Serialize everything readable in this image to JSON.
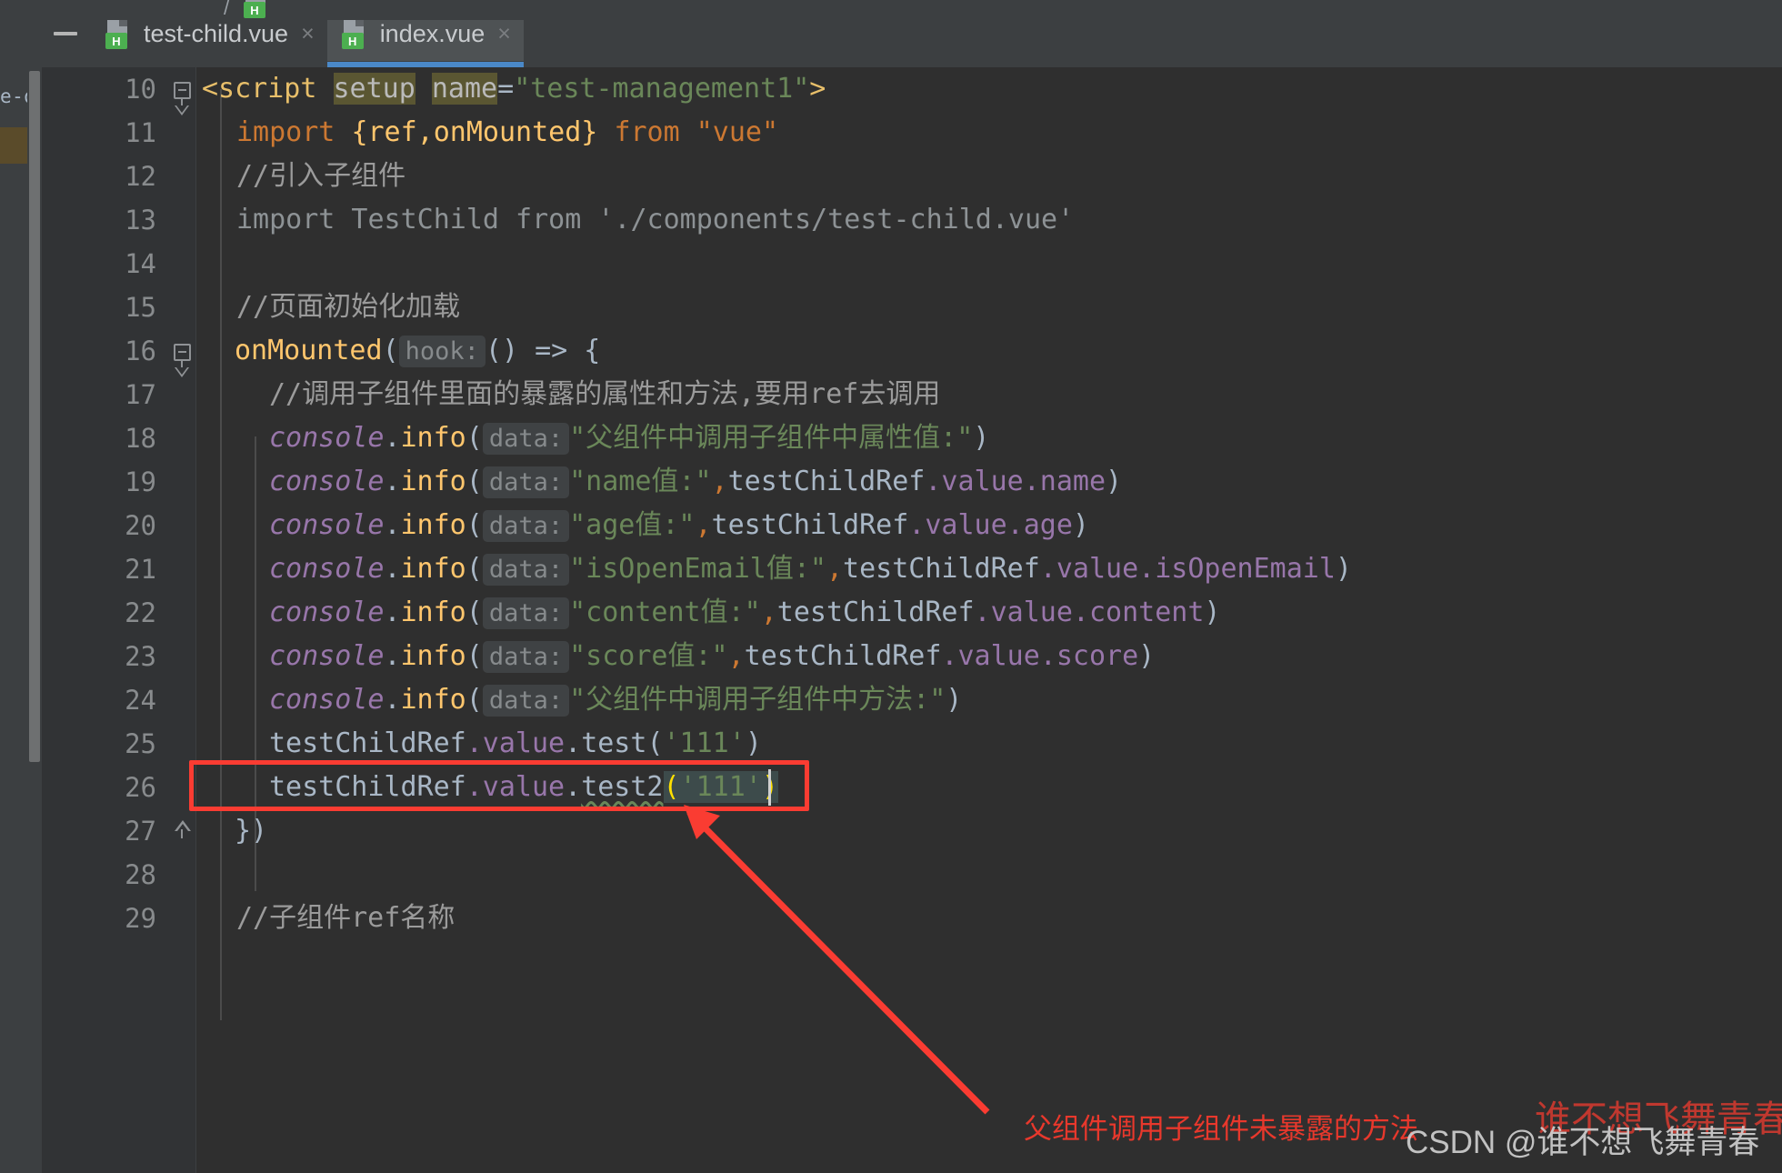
{
  "window": {
    "minimize_label": "—",
    "sliver_text": "e-de"
  },
  "tabs": [
    {
      "label": "test-child.vue",
      "icon": "vue-file-icon",
      "badge": "H",
      "close": "×",
      "active": false
    },
    {
      "label": "index.vue",
      "icon": "vue-file-icon",
      "badge": "H",
      "close": "×",
      "active": true
    }
  ],
  "editor": {
    "first_line": 10,
    "lines": [
      {
        "n": "10"
      },
      {
        "n": "11"
      },
      {
        "n": "12"
      },
      {
        "n": "13"
      },
      {
        "n": "14"
      },
      {
        "n": "15"
      },
      {
        "n": "16"
      },
      {
        "n": "17"
      },
      {
        "n": "18"
      },
      {
        "n": "19"
      },
      {
        "n": "20"
      },
      {
        "n": "21"
      },
      {
        "n": "22"
      },
      {
        "n": "23"
      },
      {
        "n": "24"
      },
      {
        "n": "25"
      },
      {
        "n": "26"
      },
      {
        "n": "27"
      },
      {
        "n": "28"
      },
      {
        "n": "29"
      }
    ],
    "code": {
      "l10": {
        "tag_open": "<script",
        "attr_setup": "setup",
        "attr_name": "name",
        "eq": "=",
        "value": "\"test-management1\"",
        "gt": ">"
      },
      "l11": {
        "kw": "import",
        "braces": "{ref,onMounted}",
        "from": "from",
        "module": "\"vue\""
      },
      "l12": {
        "comment": "//引入子组件"
      },
      "l13": {
        "text": "import TestChild from './components/test-child.vue'"
      },
      "l14": {
        "text": ""
      },
      "l15": {
        "comment": "//页面初始化加载"
      },
      "l16": {
        "fn": "onMounted",
        "lp": "(",
        "hint": "hook:",
        "args": "()",
        "arrow": "=>",
        "brace": "{"
      },
      "l17": {
        "comment": "//调用子组件里面的暴露的属性和方法,要用ref去调用"
      },
      "l18": {
        "obj": "console",
        "dot": ".",
        "fn": "info",
        "lp": "(",
        "hint": "data:",
        "str": "\"父组件中调用子组件中属性值:\"",
        "rp": ")"
      },
      "l19": {
        "obj": "console",
        "dot": ".",
        "fn": "info",
        "lp": "(",
        "hint": "data:",
        "str": "\"name值:\"",
        "comma": ",",
        "ref": "testChildRef",
        "p1": ".value",
        "p2": ".name",
        "rp": ")"
      },
      "l20": {
        "obj": "console",
        "dot": ".",
        "fn": "info",
        "lp": "(",
        "hint": "data:",
        "str": "\"age值:\"",
        "comma": ",",
        "ref": "testChildRef",
        "p1": ".value",
        "p2": ".age",
        "rp": ")"
      },
      "l21": {
        "obj": "console",
        "dot": ".",
        "fn": "info",
        "lp": "(",
        "hint": "data:",
        "str": "\"isOpenEmail值:\"",
        "comma": ",",
        "ref": "testChildRef",
        "p1": ".value",
        "p2": ".isOpenEmail",
        "rp": ")"
      },
      "l22": {
        "obj": "console",
        "dot": ".",
        "fn": "info",
        "lp": "(",
        "hint": "data:",
        "str": "\"content值:\"",
        "comma": ",",
        "ref": "testChildRef",
        "p1": ".value",
        "p2": ".content",
        "rp": ")"
      },
      "l23": {
        "obj": "console",
        "dot": ".",
        "fn": "info",
        "lp": "(",
        "hint": "data:",
        "str": "\"score值:\"",
        "comma": ",",
        "ref": "testChildRef",
        "p1": ".value",
        "p2": ".score",
        "rp": ")"
      },
      "l24": {
        "obj": "console",
        "dot": ".",
        "fn": "info",
        "lp": "(",
        "hint": "data:",
        "str": "\"父组件中调用子组件中方法:\"",
        "rp": ")"
      },
      "l25": {
        "ref": "testChildRef",
        "p1": ".value",
        "dot": ".",
        "method": "test",
        "lp": "(",
        "arg": "'111'",
        "rp": ")"
      },
      "l26": {
        "ref": "testChildRef",
        "p1": ".value",
        "dot": ".",
        "method": "test2",
        "lp": "(",
        "arg": "'111'",
        "rp": ")"
      },
      "l27": {
        "text": "})"
      },
      "l28": {
        "text": ""
      },
      "l29": {
        "comment": "//子组件ref名称"
      }
    }
  },
  "annotations": {
    "red_note": "父组件调用子组件未暴露的方法",
    "arrow": "red-arrow-icon",
    "highlight_box": "red-rectangle-highlight"
  },
  "watermarks": {
    "csdn": "CSDN @谁不想飞舞青春",
    "red_overlay": "谁不想飞舞青春"
  },
  "colors": {
    "accent_blue": "#4a88c7",
    "annotation_red": "#fa3c32",
    "editor_bg": "#2f2f2f",
    "gutter_bg": "#313335",
    "tab_bg": "#3c3f41",
    "tab_active_bg": "#4e5254",
    "string_green": "#6a8759",
    "keyword_orange": "#cc7832",
    "function_yellow": "#ffc66d",
    "object_purple": "#9876aa",
    "tag_gold": "#e8bf6a"
  }
}
